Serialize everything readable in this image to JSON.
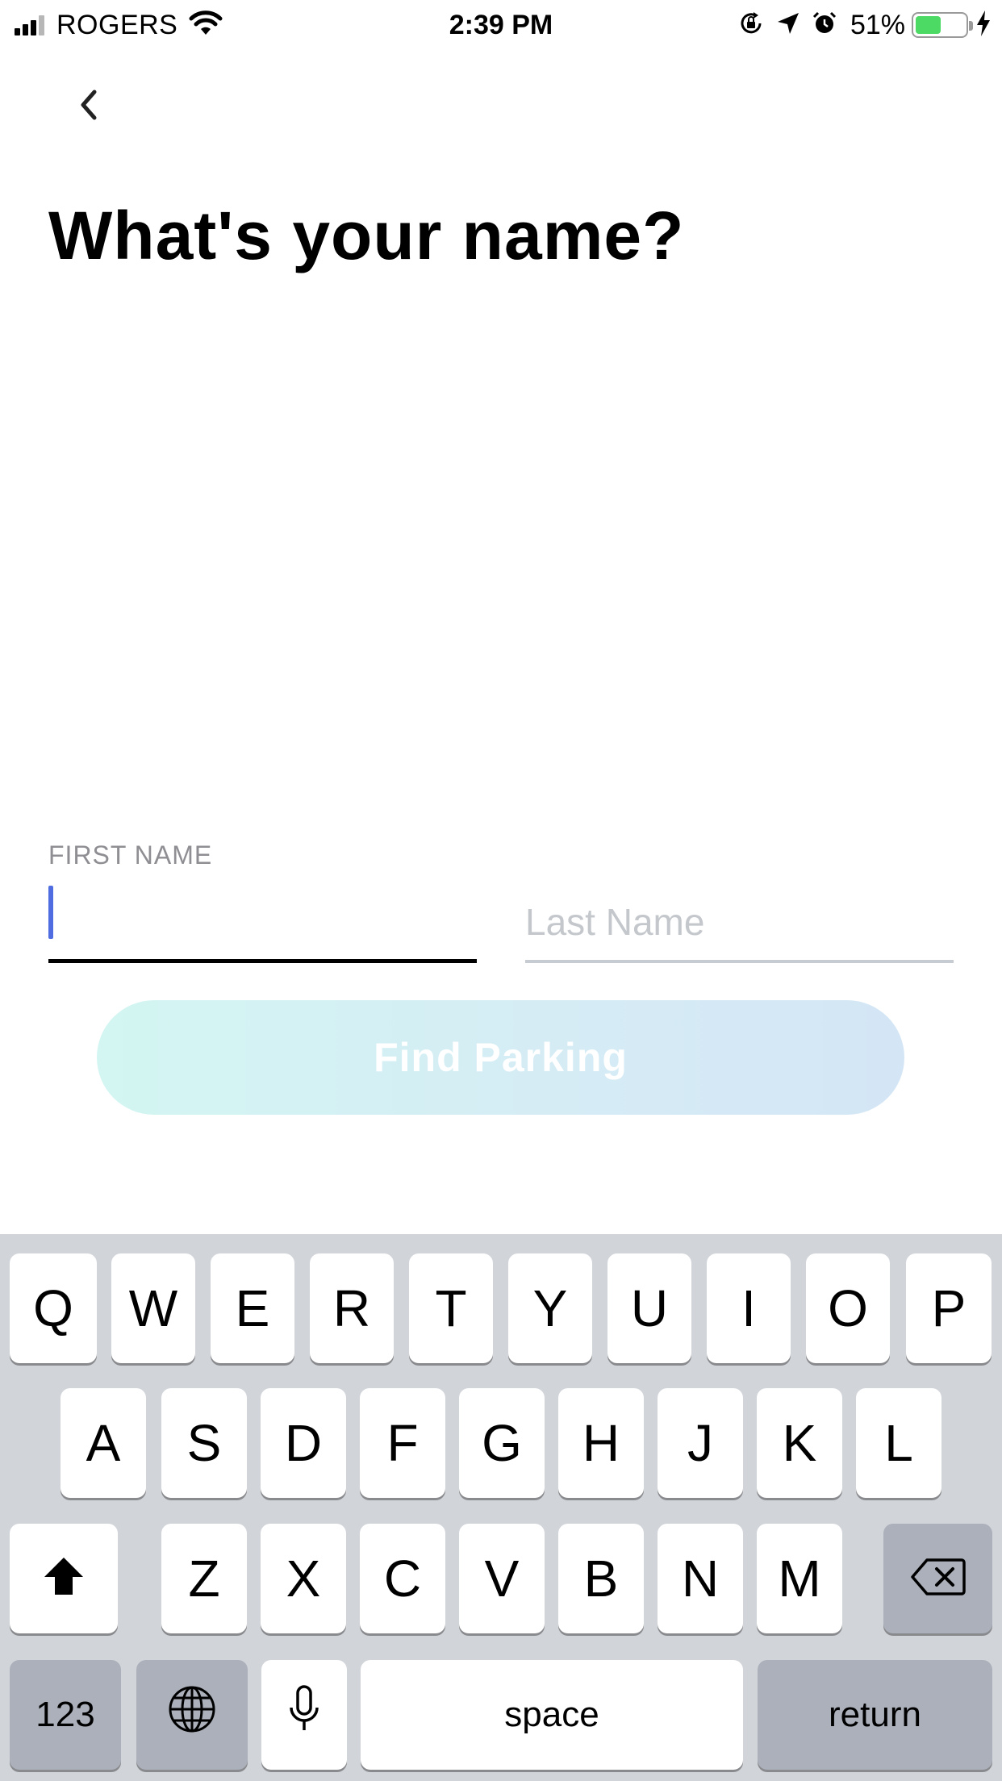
{
  "status_bar": {
    "carrier": "ROGERS",
    "time": "2:39 PM",
    "battery_percent": "51%",
    "battery_level": 0.51
  },
  "header": {
    "back_icon": "chevron-left-icon"
  },
  "page": {
    "title": "What's your name?"
  },
  "form": {
    "first_name_label": "FIRST NAME",
    "first_name_value": "",
    "last_name_placeholder": "Last Name",
    "submit_label": "Find Parking"
  },
  "keyboard": {
    "row1": [
      "Q",
      "W",
      "E",
      "R",
      "T",
      "Y",
      "U",
      "I",
      "O",
      "P"
    ],
    "row2": [
      "A",
      "S",
      "D",
      "F",
      "G",
      "H",
      "J",
      "K",
      "L"
    ],
    "row3": [
      "Z",
      "X",
      "C",
      "V",
      "B",
      "N",
      "M"
    ],
    "numbers_label": "123",
    "space_label": "space",
    "return_label": "return",
    "icons": [
      "shift-icon",
      "backspace-icon",
      "globe-icon",
      "microphone-icon"
    ]
  },
  "colors": {
    "accent_caret": "#4f6de0",
    "battery_green": "#4cd964",
    "button_gradient_start": "#d3f6f2",
    "button_gradient_end": "#d4e6f5"
  }
}
